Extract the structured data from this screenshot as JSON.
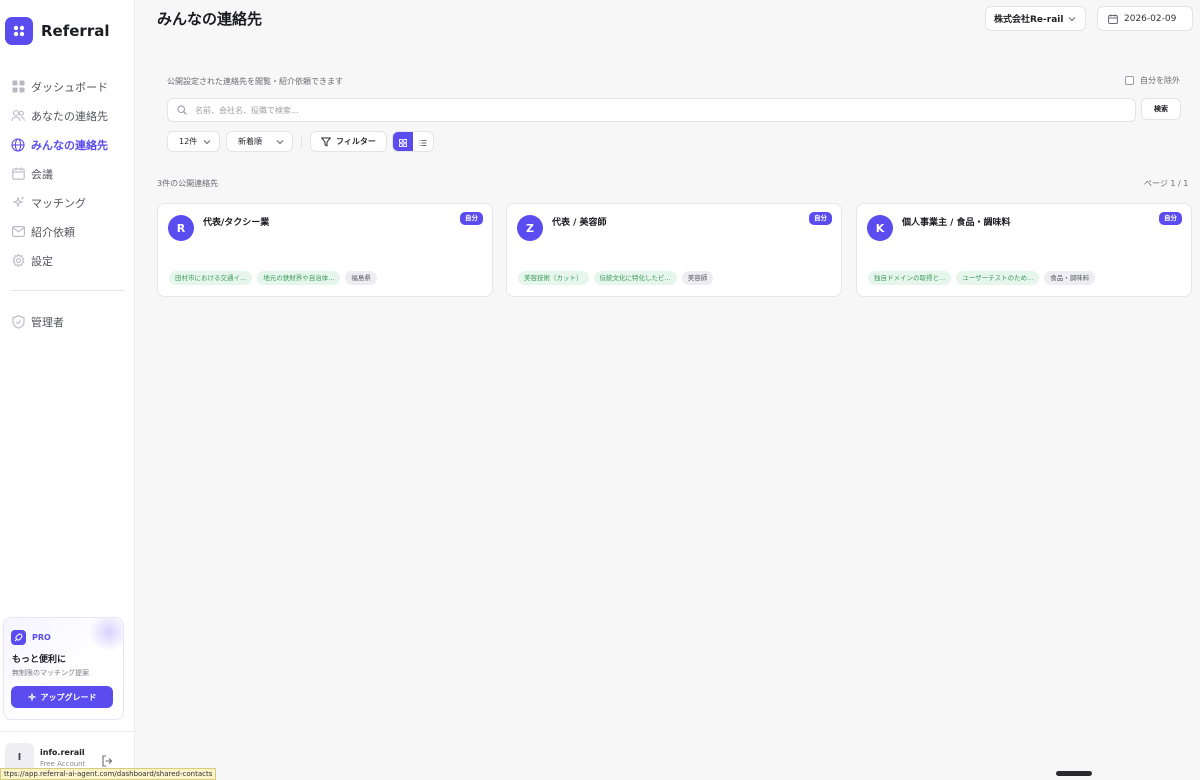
{
  "brand": {
    "name": "Referral"
  },
  "sidebar": {
    "items": [
      {
        "label": "ダッシュボード",
        "icon": "grid-icon",
        "active": false
      },
      {
        "label": "あなたの連絡先",
        "icon": "users-icon",
        "active": false
      },
      {
        "label": "みんなの連絡先",
        "icon": "globe-icon",
        "active": true
      },
      {
        "label": "会議",
        "icon": "calendar-icon",
        "active": false
      },
      {
        "label": "マッチング",
        "icon": "sparkle-icon",
        "active": false
      },
      {
        "label": "紹介依頼",
        "icon": "mail-icon",
        "active": false
      },
      {
        "label": "設定",
        "icon": "gear-icon",
        "active": false
      }
    ],
    "admin": {
      "label": "管理者",
      "icon": "shield-icon"
    }
  },
  "pro": {
    "badge": "PRO",
    "title": "もっと便利に",
    "subtitle": "無制限のマッチング提案",
    "button": "アップグレード"
  },
  "user": {
    "initial": "I",
    "name": "info.rerail",
    "plan": "Free Account"
  },
  "status_url": "ttps://app.referral-ai-agent.com/dashboard/shared-contacts",
  "header": {
    "title": "みんなの連絡先",
    "company": "株式会社Re-rail",
    "date": "2026-02-09"
  },
  "main": {
    "intro": "公開設定された連絡先を閲覧・紹介依頼できます",
    "exclude_label": "自分を除外",
    "search": {
      "placeholder": "名前、会社名、役職で検索...",
      "button": "検索"
    },
    "controls": {
      "count": "12件",
      "sort": "新着順",
      "filter": "フィルター"
    },
    "result_count": "3件の公開連絡先",
    "pagination": "ページ 1 / 1"
  },
  "colors": {
    "accent": "#5b4cf0",
    "tag_green_bg": "#e7f6ec",
    "tag_green_text": "#3a9b5c"
  },
  "cards": [
    {
      "initial": "R",
      "title": "代表/タクシー業",
      "badge": "自分",
      "tags": [
        {
          "text": "田村市における交通イ...",
          "tone": "green"
        },
        {
          "text": "地元の鉄財界や自治体...",
          "tone": "green"
        },
        {
          "text": "福島県",
          "tone": "gray"
        }
      ]
    },
    {
      "initial": "Z",
      "title": "代表 / 美容師",
      "badge": "自分",
      "tags": [
        {
          "text": "美容技術（カット）",
          "tone": "green"
        },
        {
          "text": "伝統文化に特化したビ...",
          "tone": "green"
        },
        {
          "text": "美容師",
          "tone": "gray"
        }
      ]
    },
    {
      "initial": "K",
      "title": "個人事業主 / 食品・調味料",
      "badge": "自分",
      "tags": [
        {
          "text": "独自ドメインの取得と...",
          "tone": "green"
        },
        {
          "text": "ユーザーテストのため...",
          "tone": "green"
        },
        {
          "text": "食品・調味料",
          "tone": "gray"
        }
      ]
    }
  ]
}
